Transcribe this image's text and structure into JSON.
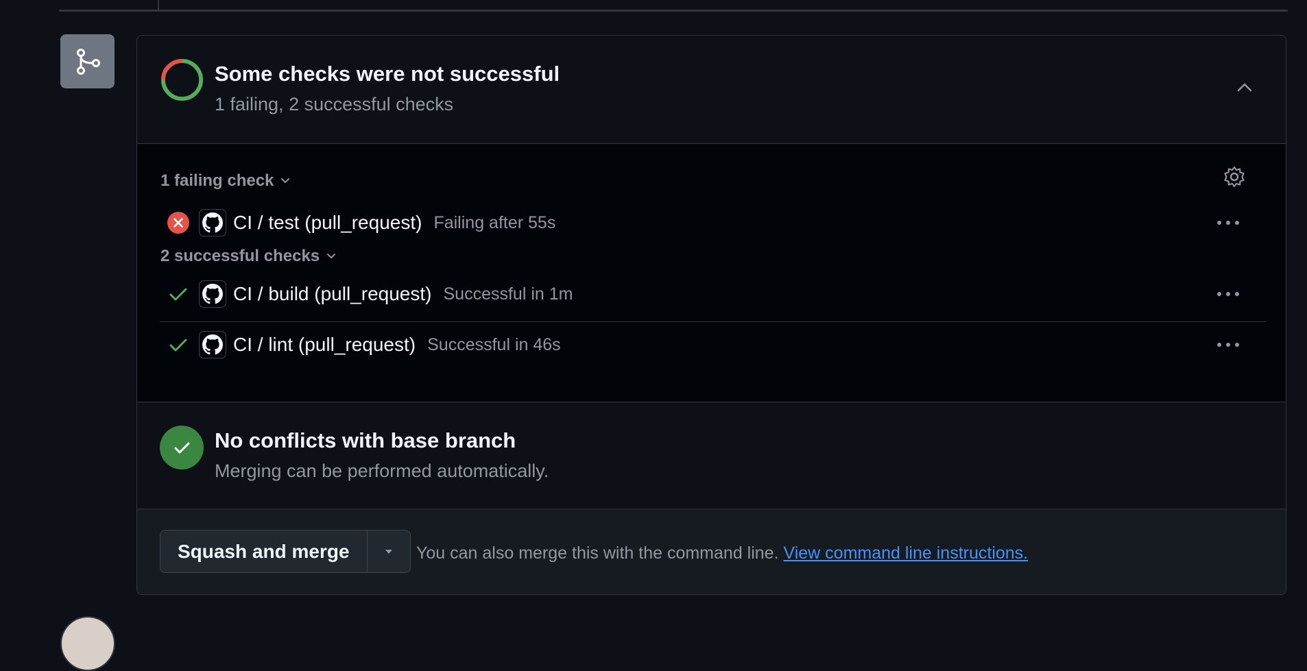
{
  "header": {
    "title": "Some checks were not successful",
    "subtitle": "1 failing, 2 successful checks"
  },
  "checks": {
    "failing_group_label": "1 failing check",
    "successful_group_label": "2 successful checks",
    "failing": [
      {
        "name": "CI / test (pull_request)",
        "status": "Failing after 55s"
      }
    ],
    "successful": [
      {
        "name": "CI / build (pull_request)",
        "status": "Successful in 1m"
      },
      {
        "name": "CI / lint (pull_request)",
        "status": "Successful in 46s"
      }
    ]
  },
  "conflicts": {
    "title": "No conflicts with base branch",
    "subtitle": "Merging can be performed automatically."
  },
  "merge": {
    "button_label": "Squash and merge",
    "hint": "You can also merge this with the command line.",
    "link": "View command line instructions."
  },
  "colors": {
    "fail": "#e5534b",
    "success": "#57ab5a",
    "link": "#4493f8",
    "badge": "#6e7681"
  },
  "icons": [
    "git-merge-icon",
    "status-ring-icon",
    "chevron-up-icon",
    "chevron-down-icon",
    "gear-icon",
    "x-circle-icon",
    "check-icon",
    "github-icon",
    "kebab-icon",
    "triangle-down-icon"
  ]
}
